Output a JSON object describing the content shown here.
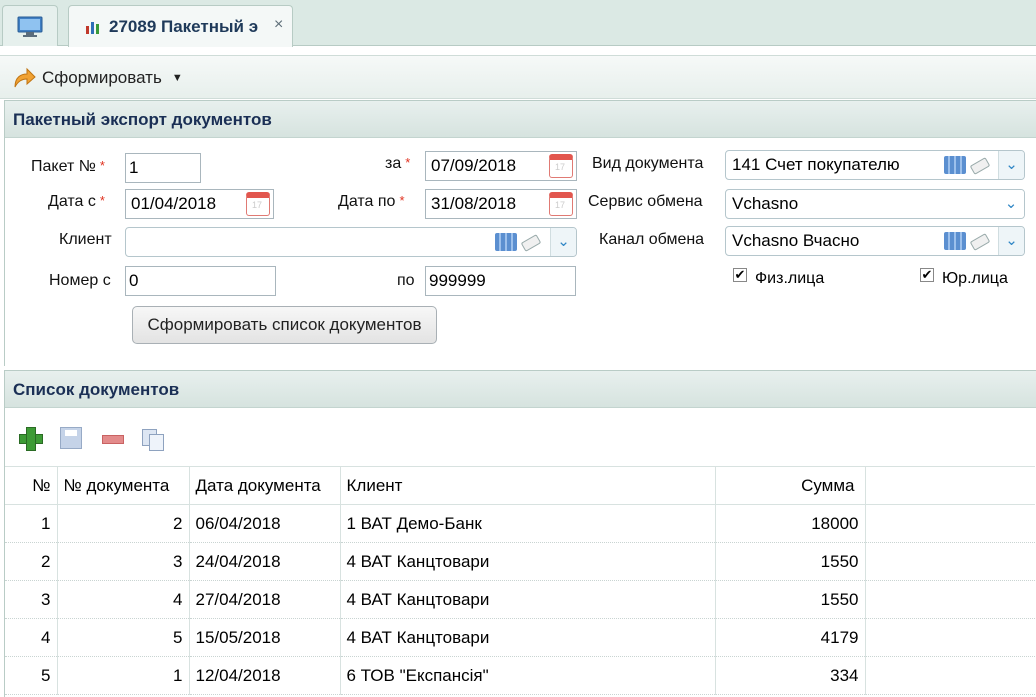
{
  "tabs": {
    "active_title": "27089 Пакетный э",
    "close_glyph": "×"
  },
  "toolbar": {
    "generate_label": "Сформировать"
  },
  "form": {
    "title": "Пакетный экспорт документов",
    "packet_label": "Пакет №",
    "packet_value": "1",
    "za_label": "за",
    "za_value": "07/09/2018",
    "doc_type_label": "Вид документа",
    "doc_type_value": "141 Счет покупателю",
    "date_from_label": "Дата с",
    "date_from_value": "01/04/2018",
    "date_to_label": "Дата по",
    "date_to_value": "31/08/2018",
    "exchange_service_label": "Сервис обмена",
    "exchange_service_value": "Vchasno",
    "client_label": "Клиент",
    "client_value": "",
    "exchange_channel_label": "Канал обмена",
    "exchange_channel_value": "Vchasno Вчасно",
    "number_from_label": "Номер с",
    "number_from_value": "0",
    "number_to_label": "по",
    "number_to_value": "999999",
    "individuals_label": "Физ.лица",
    "individuals_checked": true,
    "legal_label": "Юр.лица",
    "legal_checked": true,
    "build_list_label": "Сформировать список документов",
    "required_mark": "*"
  },
  "list": {
    "title": "Список документов",
    "columns": [
      "№",
      "№ документа",
      "Дата документа",
      "Клиент",
      "Сумма"
    ],
    "rows": [
      [
        "1",
        "2",
        "06/04/2018",
        "1 ВАТ Демо-Банк",
        "18000"
      ],
      [
        "2",
        "3",
        "24/04/2018",
        "4 ВАТ Канцтовари",
        "1550"
      ],
      [
        "3",
        "4",
        "27/04/2018",
        "4 ВАТ Канцтовари",
        "1550"
      ],
      [
        "4",
        "5",
        "15/05/2018",
        "4 ВАТ Канцтовари",
        "4179"
      ],
      [
        "5",
        "1",
        "12/04/2018",
        "6 ТОВ \"Експансія\"",
        "334"
      ]
    ]
  }
}
